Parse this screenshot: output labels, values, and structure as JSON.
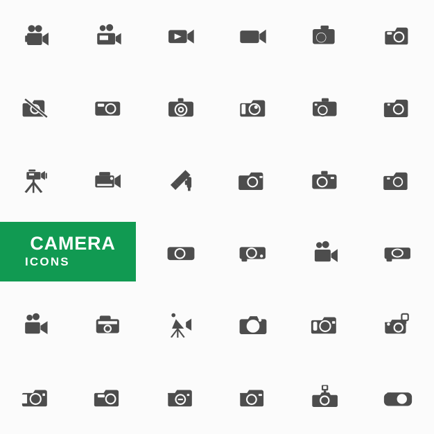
{
  "page": {
    "background_color": "#fbfbfb",
    "icon_color": "#4d4d4d",
    "accent_color": "#119a52",
    "columns": 6,
    "rows": 6
  },
  "banner": {
    "title": "CAMERA",
    "subtitle": "ICONS",
    "background_color": "#119a52",
    "text_color": "#ffffff"
  },
  "icons": [
    {
      "name": "movie-camera-reels-icon",
      "row": 1,
      "col": 1
    },
    {
      "name": "movie-camera-reels-body-icon",
      "row": 1,
      "col": 2
    },
    {
      "name": "video-camera-play-icon",
      "row": 1,
      "col": 3
    },
    {
      "name": "video-camera-plain-icon",
      "row": 1,
      "col": 4
    },
    {
      "name": "dslr-camera-big-lens-icon",
      "row": 1,
      "col": 5
    },
    {
      "name": "compact-camera-viewfinder-icon",
      "row": 1,
      "col": 6
    },
    {
      "name": "no-camera-slashed-icon",
      "row": 2,
      "col": 1
    },
    {
      "name": "compact-camera-flat-icon",
      "row": 2,
      "col": 2
    },
    {
      "name": "camera-target-lens-icon",
      "row": 2,
      "col": 3
    },
    {
      "name": "camera-side-grip-icon",
      "row": 2,
      "col": 4
    },
    {
      "name": "dslr-camera-offset-lens-icon",
      "row": 2,
      "col": 5
    },
    {
      "name": "camera-rounded-lens-icon",
      "row": 2,
      "col": 6
    },
    {
      "name": "video-camera-tripod-icon",
      "row": 3,
      "col": 1
    },
    {
      "name": "camcorder-icon",
      "row": 3,
      "col": 2
    },
    {
      "name": "cctv-security-camera-icon",
      "row": 3,
      "col": 3
    },
    {
      "name": "dslr-camera-wide-icon",
      "row": 3,
      "col": 4
    },
    {
      "name": "camera-lens-left-icon",
      "row": 3,
      "col": 5
    },
    {
      "name": "camera-thin-lens-icon",
      "row": 3,
      "col": 6
    },
    {
      "name": "camera-icons-banner",
      "row": 4,
      "col": 1
    },
    {
      "name": "camera-hump-icon",
      "row": 4,
      "col": 2
    },
    {
      "name": "camera-wide-body-icon",
      "row": 4,
      "col": 3
    },
    {
      "name": "projector-camera-icon",
      "row": 4,
      "col": 4
    },
    {
      "name": "movie-camera-two-reels-icon",
      "row": 4,
      "col": 5
    },
    {
      "name": "projector-oval-lens-icon",
      "row": 4,
      "col": 6
    },
    {
      "name": "movie-camera-compact-icon",
      "row": 5,
      "col": 1
    },
    {
      "name": "instant-camera-icon",
      "row": 5,
      "col": 2
    },
    {
      "name": "movie-camera-tripod-icon",
      "row": 5,
      "col": 3
    },
    {
      "name": "camera-large-lens-icon",
      "row": 5,
      "col": 4
    },
    {
      "name": "camera-grip-lens-icon",
      "row": 5,
      "col": 5
    },
    {
      "name": "camera-external-flash-icon",
      "row": 5,
      "col": 6
    },
    {
      "name": "camera-left-grip-icon",
      "row": 6,
      "col": 1
    },
    {
      "name": "camera-viewfinder-bar-icon",
      "row": 6,
      "col": 2
    },
    {
      "name": "camera-minus-lens-icon",
      "row": 6,
      "col": 3
    },
    {
      "name": "camera-circle-lens-icon",
      "row": 6,
      "col": 4
    },
    {
      "name": "camera-flash-mounted-icon",
      "row": 6,
      "col": 5
    },
    {
      "name": "camera-oval-body-icon",
      "row": 6,
      "col": 6
    }
  ]
}
